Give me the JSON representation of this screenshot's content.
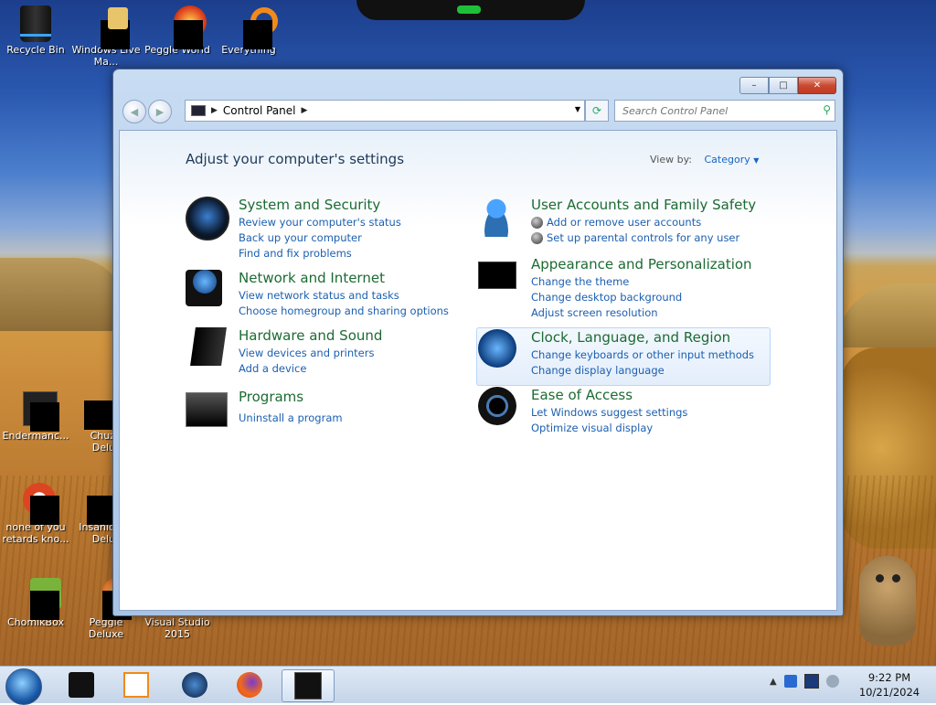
{
  "desktop": {
    "icons": [
      {
        "label": "Recycle Bin"
      },
      {
        "label": "Windows Live Ma..."
      },
      {
        "label": "Peggle World"
      },
      {
        "label": "Everything"
      },
      {
        "label": "Endermanc..."
      },
      {
        "label": "Chuz Delu"
      },
      {
        "label": "none of you retards kno..."
      },
      {
        "label": "Insaniq Delu"
      },
      {
        "label": "ChomikBox"
      },
      {
        "label": "Peggle Deluxe"
      },
      {
        "label": "Visual Studio 2015"
      }
    ]
  },
  "window": {
    "caption_buttons": {
      "minimize": "–",
      "maximize": "□",
      "close": "✕"
    },
    "nav": {
      "back": "◀",
      "forward": "▶"
    },
    "address": {
      "segment": "Control Panel",
      "separator": "▶",
      "dropdown": "▼"
    },
    "refresh": "⟳",
    "search": {
      "placeholder": "Search Control Panel",
      "icon": "search-icon"
    },
    "heading": "Adjust your computer's settings",
    "view_by": {
      "label": "View by:",
      "value": "Category",
      "arrow": "▼"
    },
    "categories": [
      {
        "title": "System and Security",
        "icon": "system-security-icon",
        "links": [
          "Review your computer's status",
          "Back up your computer",
          "Find and fix problems"
        ]
      },
      {
        "title": "Network and Internet",
        "icon": "network-globe-icon",
        "links": [
          "View network status and tasks",
          "Choose homegroup and sharing options"
        ]
      },
      {
        "title": "Hardware and Sound",
        "icon": "printer-speaker-icon",
        "links": [
          "View devices and printers",
          "Add a device"
        ]
      },
      {
        "title": "Programs",
        "icon": "programs-icon",
        "links": [
          "Uninstall a program"
        ]
      },
      {
        "title": "User Accounts and Family Safety",
        "icon": "users-icon",
        "links": [
          "Add or remove user accounts",
          "Set up parental controls for any user"
        ]
      },
      {
        "title": "Appearance and Personalization",
        "icon": "monitor-icon",
        "links": [
          "Change the theme",
          "Change desktop background",
          "Adjust screen resolution"
        ]
      },
      {
        "title": "Clock, Language, and Region",
        "icon": "clock-globe-icon",
        "links": [
          "Change keyboards or other input methods",
          "Change display language"
        ]
      },
      {
        "title": "Ease of Access",
        "icon": "ease-of-access-icon",
        "links": [
          "Let Windows suggest settings",
          "Optimize visual display"
        ]
      }
    ]
  },
  "taskbar": {
    "tray_arrow": "▲",
    "time": "9:22 PM",
    "date": "10/21/2024"
  },
  "colors": {
    "category_title": "#1c6b33",
    "link": "#1c5fb0",
    "heading": "#1e395b"
  }
}
